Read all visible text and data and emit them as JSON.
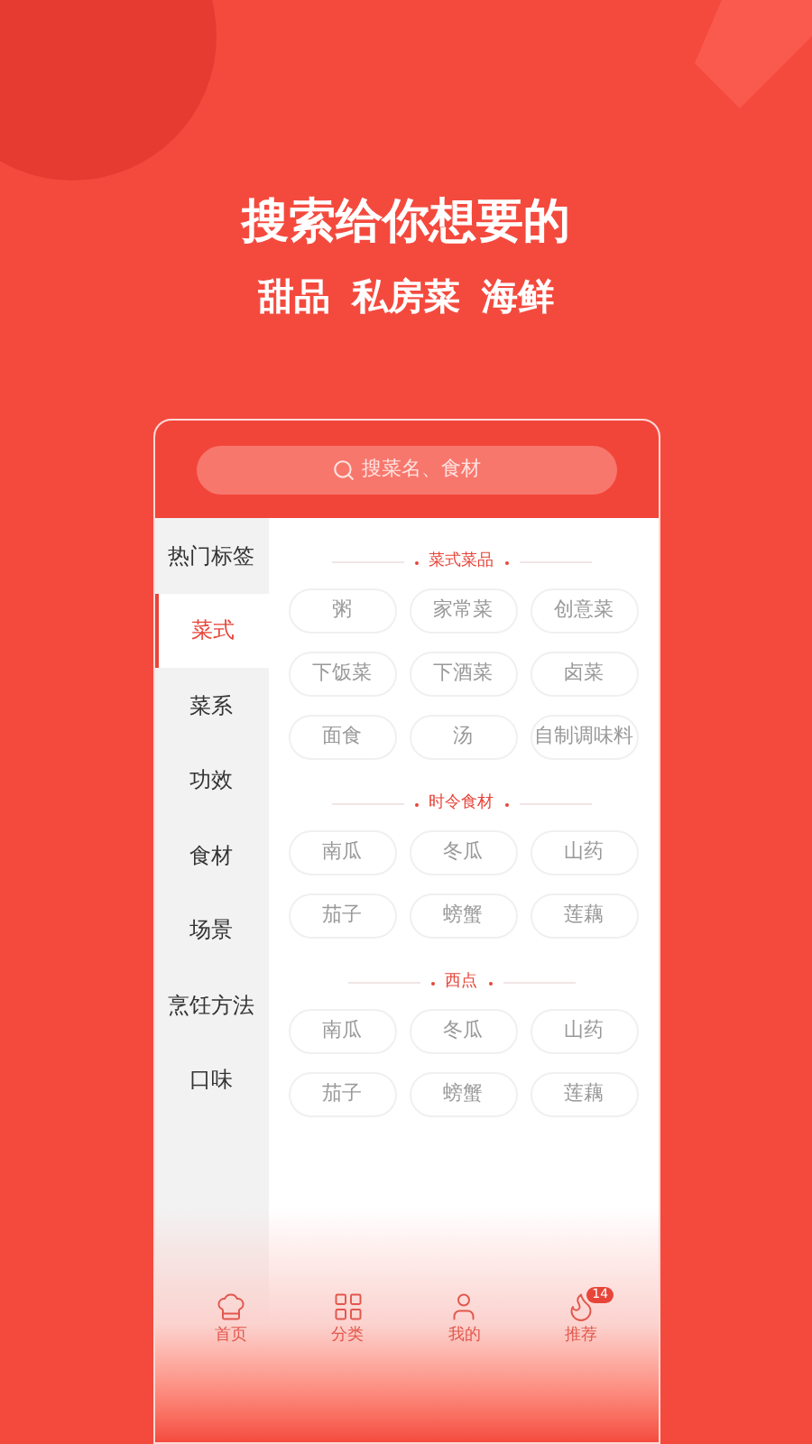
{
  "hero": {
    "title": "搜索给你想要的",
    "keywords": [
      "甜品",
      "私房菜",
      "海鲜"
    ]
  },
  "search": {
    "placeholder": "搜菜名、食材"
  },
  "sidebar": {
    "items": [
      {
        "label": "热门标签",
        "selected": false
      },
      {
        "label": "菜式",
        "selected": true
      },
      {
        "label": "菜系",
        "selected": false
      },
      {
        "label": "功效",
        "selected": false
      },
      {
        "label": "食材",
        "selected": false
      },
      {
        "label": "场景",
        "selected": false
      },
      {
        "label": "烹饪方法",
        "selected": false
      },
      {
        "label": "口味",
        "selected": false
      }
    ]
  },
  "sections": [
    {
      "title": "菜式菜品",
      "tags": [
        "粥",
        "家常菜",
        "创意菜",
        "下饭菜",
        "下酒菜",
        "卤菜",
        "面食",
        "汤",
        "自制调味料"
      ]
    },
    {
      "title": "时令食材",
      "tags": [
        "南瓜",
        "冬瓜",
        "山药",
        "茄子",
        "螃蟹",
        "莲藕"
      ]
    },
    {
      "title": "西点",
      "tags": [
        "南瓜",
        "冬瓜",
        "山药",
        "茄子",
        "螃蟹",
        "莲藕"
      ]
    }
  ],
  "tab_bar": [
    {
      "kind": "home",
      "label": "首页"
    },
    {
      "kind": "category",
      "label": "分类"
    },
    {
      "kind": "profile",
      "label": "我的"
    },
    {
      "kind": "recommend",
      "label": "推荐",
      "badge": "14"
    }
  ]
}
